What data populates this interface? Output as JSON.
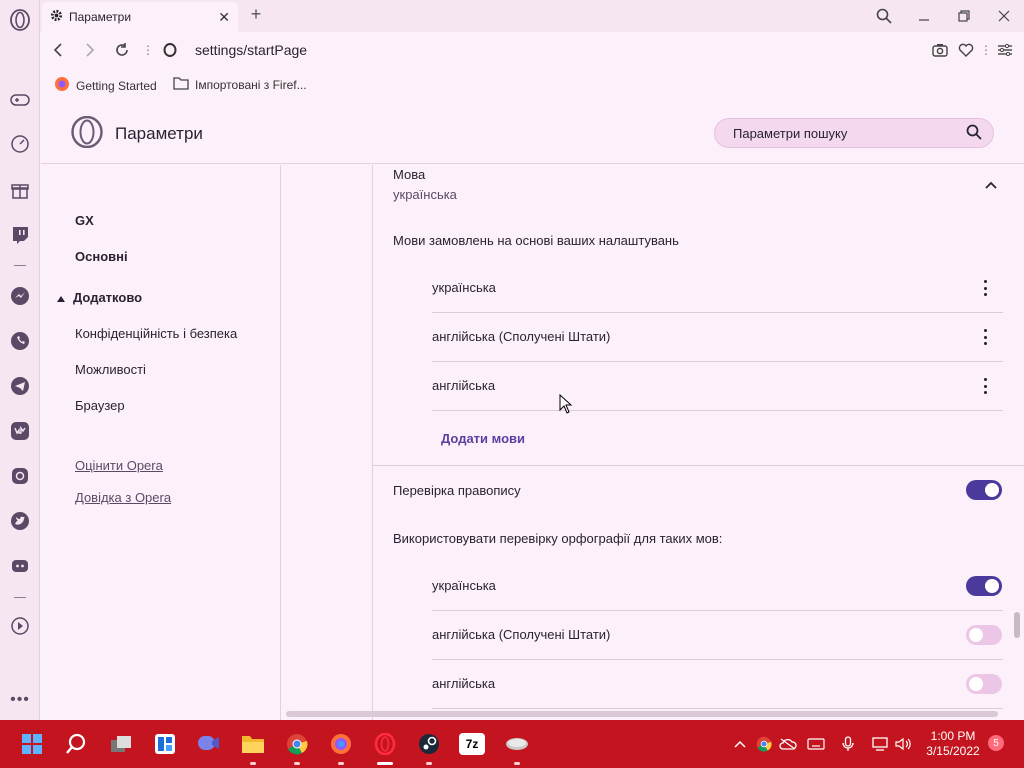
{
  "tab": {
    "title": "Параметри"
  },
  "address": {
    "url": "settings/startPage"
  },
  "bookmarks": [
    {
      "label": "Getting Started",
      "icon": "firefox-icon"
    },
    {
      "label": "Імпортовані з Firef...",
      "icon": "folder-icon"
    }
  ],
  "header": {
    "title": "Параметри",
    "search_placeholder": "Параметри пошуку"
  },
  "nav": {
    "gx": "GX",
    "basic": "Основні",
    "advanced": "Додатково",
    "privacy": "Конфіденційність і безпека",
    "features": "Можливості",
    "browser": "Браузер",
    "rate": "Оцінити Opera",
    "help": "Довідка з Opera"
  },
  "language": {
    "title": "Мова",
    "current": "українська",
    "order_label": "Мови замовлень на основі ваших налаштувань",
    "languages": [
      "українська",
      "англійська (Сполучені Штати)",
      "англійська"
    ],
    "add_link": "Додати мови"
  },
  "spellcheck": {
    "label": "Перевірка правопису",
    "enabled": true,
    "use_label": "Використовувати перевірку орфографії для таких мов:",
    "languages": [
      {
        "name": "українська",
        "enabled": true
      },
      {
        "name": "англійська (Сполучені Штати)",
        "enabled": false
      },
      {
        "name": "англійська",
        "enabled": false
      }
    ]
  },
  "taskbar": {
    "clock_time": "1:00 PM",
    "clock_date": "3/15/2022",
    "notifications": "5",
    "sevenzip_label": "7z"
  },
  "colors": {
    "accent": "#4b3a9c",
    "taskbar": "#c4141f",
    "background": "#fcf1fa"
  }
}
